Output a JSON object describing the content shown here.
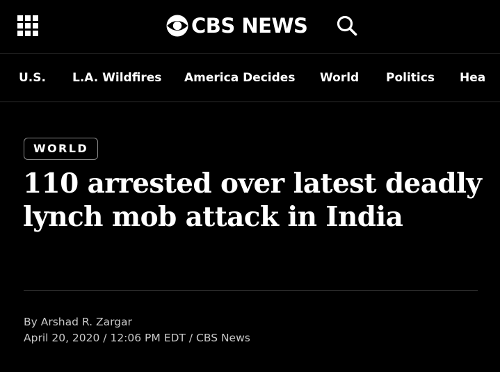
{
  "header": {
    "logo_text": "CBS NEWS",
    "menu_icon": "grid-menu-icon",
    "search_icon": "search-icon"
  },
  "nav": {
    "items": [
      {
        "label": "U.S."
      },
      {
        "label": "L.A. Wildfires"
      },
      {
        "label": "America Decides"
      },
      {
        "label": "World"
      },
      {
        "label": "Politics"
      },
      {
        "label": "Hea"
      }
    ]
  },
  "article": {
    "category": "WORLD",
    "headline": "110 arrested over latest deadly lynch mob attack in India",
    "by_prefix": "By",
    "author": "Arshad R. Zargar",
    "date": "April 20, 2020 / 12:06 PM EDT",
    "date_separator": "/",
    "source": "CBS News"
  },
  "colors": {
    "background": "#000000",
    "text": "#ffffff",
    "meta_text": "#c9c9c9",
    "divider": "#333333"
  }
}
